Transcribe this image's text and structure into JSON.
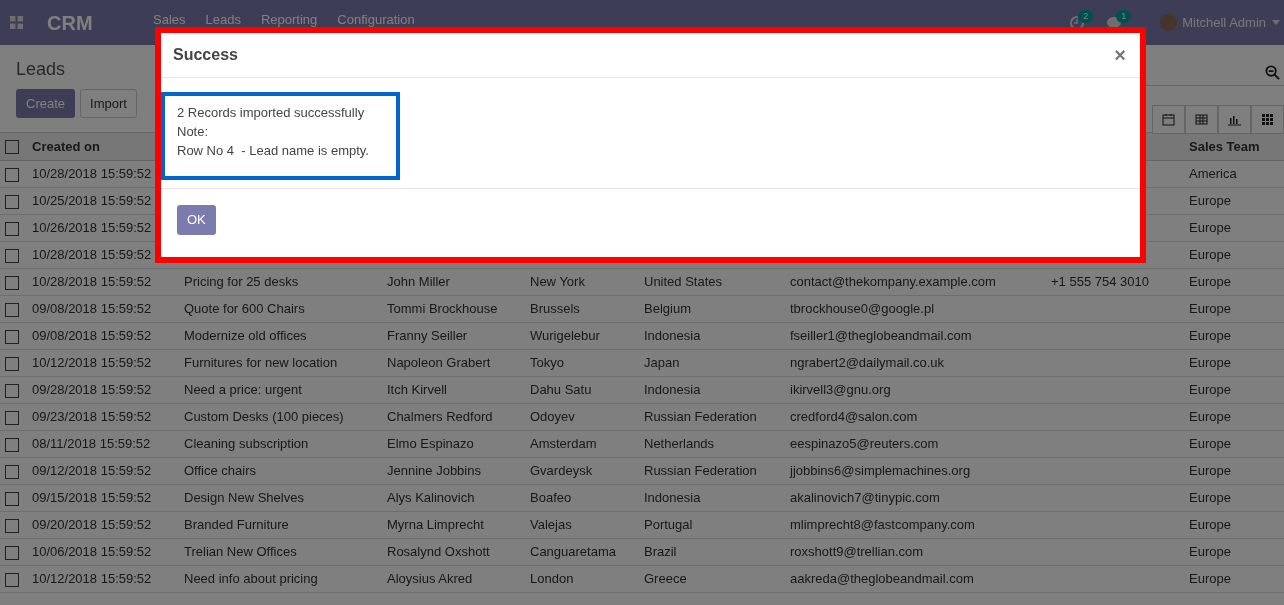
{
  "navbar": {
    "app": "CRM",
    "menus": [
      "Sales",
      "Leads",
      "Reporting",
      "Configuration"
    ],
    "activity_count": "2",
    "message_count": "1",
    "user": "Mitchell Admin"
  },
  "control_panel": {
    "title": "Leads",
    "buttons": [
      "Create",
      "Import"
    ]
  },
  "table": {
    "all_selected": false,
    "columns": {
      "created_on": "Created on",
      "sales_team": "Sales Team"
    },
    "rows": [
      {
        "selected": false,
        "created_on": "10/28/2018 15:59:52",
        "sales_team": "America"
      },
      {
        "selected": false,
        "created_on": "10/25/2018 15:59:52",
        "sales_team": "Europe"
      },
      {
        "selected": false,
        "created_on": "10/26/2018 15:59:52",
        "sales_team": "Europe"
      },
      {
        "selected": false,
        "created_on": "10/28/2018 15:59:52",
        "sales_team": "Europe"
      },
      {
        "selected": false,
        "created_on": "10/28/2018 15:59:52",
        "opportunity": "Pricing for 25 desks",
        "contact": "John Miller",
        "city": "New York",
        "country": "United States",
        "email": "contact@thekompany.example.com",
        "phone": "+1 555 754 3010",
        "sales_team": "Europe"
      },
      {
        "selected": false,
        "created_on": "09/08/2018 15:59:52",
        "opportunity": "Quote for 600 Chairs",
        "contact": "Tommi Brockhouse",
        "city": "Brussels",
        "country": "Belgium",
        "email": "tbrockhouse0@google.pl",
        "sales_team": "Europe"
      },
      {
        "selected": false,
        "created_on": "09/08/2018 15:59:52",
        "opportunity": "Modernize old offices",
        "contact": "Franny Seiller",
        "city": "Wurigelebur",
        "country": "Indonesia",
        "email": "fseiller1@theglobeandmail.com",
        "sales_team": "Europe"
      },
      {
        "selected": false,
        "created_on": "10/12/2018 15:59:52",
        "opportunity": "Furnitures for new location",
        "contact": "Napoleon Grabert",
        "city": "Tokyo",
        "country": "Japan",
        "email": "ngrabert2@dailymail.co.uk",
        "sales_team": "Europe"
      },
      {
        "selected": false,
        "created_on": "09/28/2018 15:59:52",
        "opportunity": "Need a price: urgent",
        "contact": "Itch Kirvell",
        "city": "Dahu Satu",
        "country": "Indonesia",
        "email": "ikirvell3@gnu.org",
        "sales_team": "Europe"
      },
      {
        "selected": false,
        "created_on": "09/23/2018 15:59:52",
        "opportunity": "Custom Desks (100 pieces)",
        "contact": "Chalmers Redford",
        "city": "Odoyev",
        "country": "Russian Federation",
        "email": "credford4@salon.com",
        "sales_team": "Europe"
      },
      {
        "selected": false,
        "created_on": "08/11/2018 15:59:52",
        "opportunity": "Cleaning subscription",
        "contact": "Elmo Espinazo",
        "city": "Amsterdam",
        "country": "Netherlands",
        "email": "eespinazo5@reuters.com",
        "sales_team": "Europe"
      },
      {
        "selected": false,
        "created_on": "09/12/2018 15:59:52",
        "opportunity": "Office chairs",
        "contact": "Jennine Jobbins",
        "city": "Gvardeysk",
        "country": "Russian Federation",
        "email": "jjobbins6@simplemachines.org",
        "sales_team": "Europe"
      },
      {
        "selected": false,
        "created_on": "09/15/2018 15:59:52",
        "opportunity": "Design New Shelves",
        "contact": "Alys Kalinovich",
        "city": "Boafeo",
        "country": "Indonesia",
        "email": "akalinovich7@tinypic.com",
        "sales_team": "Europe"
      },
      {
        "selected": false,
        "created_on": "09/20/2018 15:59:52",
        "opportunity": "Branded Furniture",
        "contact": "Myrna Limprecht",
        "city": "Valejas",
        "country": "Portugal",
        "email": "mlimprecht8@fastcompany.com",
        "sales_team": "Europe"
      },
      {
        "selected": false,
        "created_on": "10/06/2018 15:59:52",
        "opportunity": "Trelian New Offices",
        "contact": "Rosalynd Oxshott",
        "city": "Canguaretama",
        "country": "Brazil",
        "email": "roxshott9@trellian.com",
        "sales_team": "Europe"
      },
      {
        "selected": false,
        "created_on": "10/12/2018 15:59:52",
        "opportunity": "Need info about pricing",
        "contact": "Aloysius Akred",
        "city": "London",
        "country": "Greece",
        "email": "aakreda@theglobeandmail.com",
        "sales_team": "Europe"
      }
    ]
  },
  "dialog": {
    "title": "Success",
    "close": "×",
    "message": [
      "2 Records imported successfully",
      "Note:",
      "Row No 4  - Lead name is empty."
    ],
    "button": "OK"
  }
}
